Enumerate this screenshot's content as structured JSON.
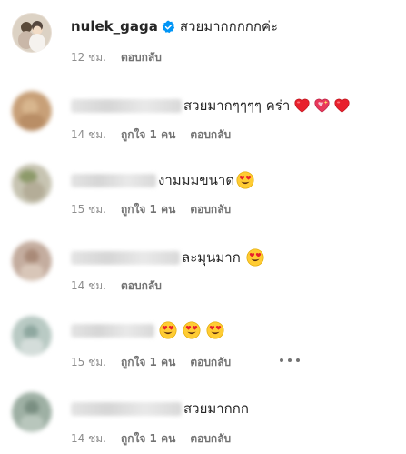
{
  "colors": {
    "verified": "#0095f6",
    "heart": "#ed1c24",
    "meta_text": "#8e8e8e",
    "text": "#262626"
  },
  "comments": [
    {
      "username": "nulek_gaga",
      "verified": true,
      "text": "สวยมากกกกกค่ะ",
      "time": "12 ชม.",
      "reply": "ตอบกลับ"
    },
    {
      "username_blurred": true,
      "text": "สวยมากๆๆๆๆ คร่า",
      "emojis": [
        "red-heart",
        "sparkling-heart",
        "red-heart"
      ],
      "time": "14 ชม.",
      "likes": "ถูกใจ 1 คน",
      "reply": "ตอบกลับ"
    },
    {
      "username_blurred": true,
      "text": "งามมมขนาด",
      "emojis": [
        "heart-eyes-face"
      ],
      "time": "15 ชม.",
      "likes": "ถูกใจ 1 คน",
      "reply": "ตอบกลับ"
    },
    {
      "username_blurred": true,
      "text": "ละมุนมาก",
      "emojis": [
        "heart-eyes-face"
      ],
      "time": "14 ชม.",
      "reply": "ตอบกลับ"
    },
    {
      "username_blurred": true,
      "text": "",
      "emojis": [
        "heart-eyes-face",
        "heart-eyes-face",
        "heart-eyes-face"
      ],
      "time": "15 ชม.",
      "likes": "ถูกใจ 1 คน",
      "reply": "ตอบกลับ",
      "more_icon": "more-options-icon"
    },
    {
      "username_blurred": true,
      "text": "สวยมากกก",
      "time": "14 ชม.",
      "likes": "ถูกใจ 1 คน",
      "reply": "ตอบกลับ"
    }
  ]
}
